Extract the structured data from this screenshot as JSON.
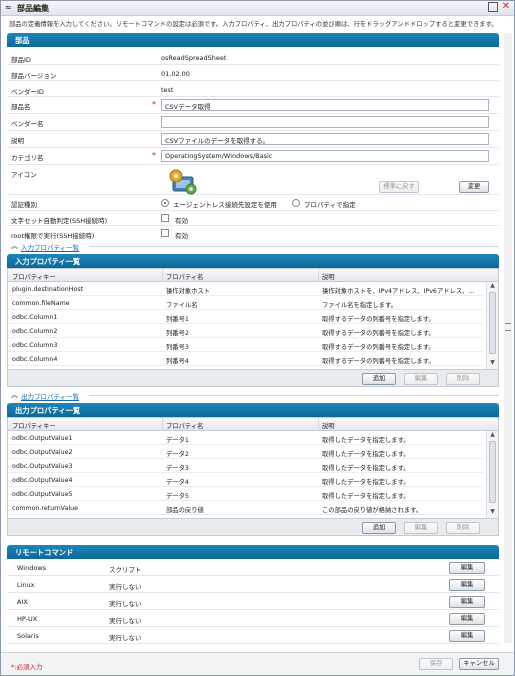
{
  "window": {
    "title": "部品編集",
    "description": "部品の定義情報を入力してください。リモートコマンドの設定は必須です。入力プロパティ、出力プロパティの並び順は、行をドラッグアンドドロップすると変更できます。"
  },
  "component": {
    "section_title": "部品",
    "fields": {
      "id_label": "部品ID",
      "id_value": "osReadSpreadSheet",
      "version_label": "部品バージョン",
      "version_value": "01.02.00",
      "vendor_id_label": "ベンダーID",
      "vendor_id_value": "test",
      "name_label": "部品名",
      "name_value": "CSVデータ取得",
      "vendor_name_label": "ベンダー名",
      "vendor_name_value": "",
      "description_label": "説明",
      "description_value": "CSVファイルのデータを取得する。",
      "category_label": "カテゴリ名",
      "category_value": "OperatingSystem/Windows/Basic",
      "icon_label": "アイコン",
      "icon_reset_button": "標準に戻す",
      "icon_change_button": "変更",
      "auth_label": "認証種別",
      "auth_option_agentless": "エージェントレス接続先設定を使用",
      "auth_option_property": "プロパティで指定",
      "charset_label": "文字セット自動判定(SSH接続時)",
      "charset_checkbox": "有効",
      "root_label": "root権限で実行(SSH接続時)",
      "root_checkbox": "有効"
    }
  },
  "input_properties": {
    "link": "入力プロパティ一覧",
    "title": "入力プロパティ一覧",
    "columns": [
      "プロパティキー",
      "プロパティ名",
      "説明"
    ],
    "rows": [
      [
        "plugin.destinationHost",
        "操作対象ホスト",
        "操作対象ホストを、IPv4アドレス、IPv6アドレス、…"
      ],
      [
        "common.fileName",
        "ファイル名",
        "ファイル名を指定します。"
      ],
      [
        "odbc.Column1",
        "列番号1",
        "取得するデータの列番号を指定します。"
      ],
      [
        "odbc.Column2",
        "列番号2",
        "取得するデータの列番号を指定します。"
      ],
      [
        "odbc.Column3",
        "列番号3",
        "取得するデータの列番号を指定します。"
      ],
      [
        "odbc.Column4",
        "列番号4",
        "取得するデータの列番号を指定します。"
      ]
    ],
    "buttons": {
      "add": "追加",
      "edit": "編集",
      "delete": "削除"
    }
  },
  "output_properties": {
    "link": "出力プロパティ一覧",
    "title": "出力プロパティ一覧",
    "columns": [
      "プロパティキー",
      "プロパティ名",
      "説明"
    ],
    "rows": [
      [
        "odbc.OutputValue1",
        "データ1",
        "取得したデータを指定します。"
      ],
      [
        "odbc.OutputValue2",
        "データ2",
        "取得したデータを指定します。"
      ],
      [
        "odbc.OutputValue3",
        "データ3",
        "取得したデータを指定します。"
      ],
      [
        "odbc.OutputValue4",
        "データ4",
        "取得したデータを指定します。"
      ],
      [
        "odbc.OutputValue5",
        "データ5",
        "取得したデータを指定します。"
      ],
      [
        "common.returnValue",
        "部品の戻り値",
        "この部品の戻り値が格納されます。"
      ]
    ],
    "buttons": {
      "add": "追加",
      "edit": "編集",
      "delete": "削除"
    }
  },
  "remote_command": {
    "title": "リモートコマンド",
    "edit_label": "編集",
    "rows": [
      {
        "os": "Windows",
        "status": "スクリプト"
      },
      {
        "os": "Linux",
        "status": "実行しない"
      },
      {
        "os": "AIX",
        "status": "実行しない"
      },
      {
        "os": "HP-UX",
        "status": "実行しない"
      },
      {
        "os": "Solaris",
        "status": "実行しない"
      }
    ]
  },
  "footer": {
    "required_note": "*:必須入力",
    "save_button": "保存",
    "cancel_button": "キャンセル"
  },
  "colors": {
    "panel_header": "#0d6795",
    "required": "#d01818",
    "link": "#1766b4"
  }
}
